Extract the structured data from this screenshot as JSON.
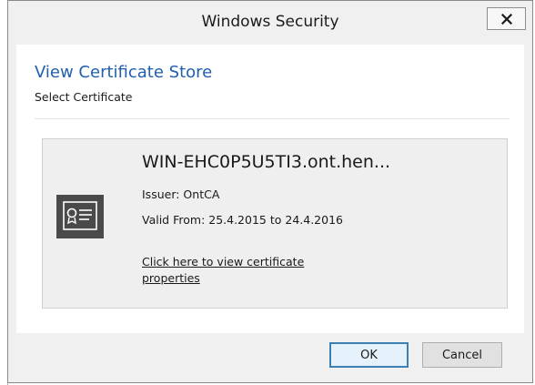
{
  "window": {
    "title": "Windows Security",
    "close_icon": "close-x-icon"
  },
  "content": {
    "heading": "View Certificate Store",
    "subheading": "Select Certificate"
  },
  "certificate": {
    "icon": "certificate-icon",
    "name": "WIN-EHC0P5U5TI3.ont.hen...",
    "issuer": "Issuer: OntCA",
    "valid": "Valid From: 25.4.2015 to 24.4.2016",
    "link": "Click here to view certificate properties"
  },
  "buttons": {
    "ok": "OK",
    "cancel": "Cancel"
  },
  "colors": {
    "heading": "#1f5fae",
    "dialog_bg": "#f0f0f0",
    "ok_border": "#3c7fb1",
    "ok_bg": "#e5f1fb"
  }
}
